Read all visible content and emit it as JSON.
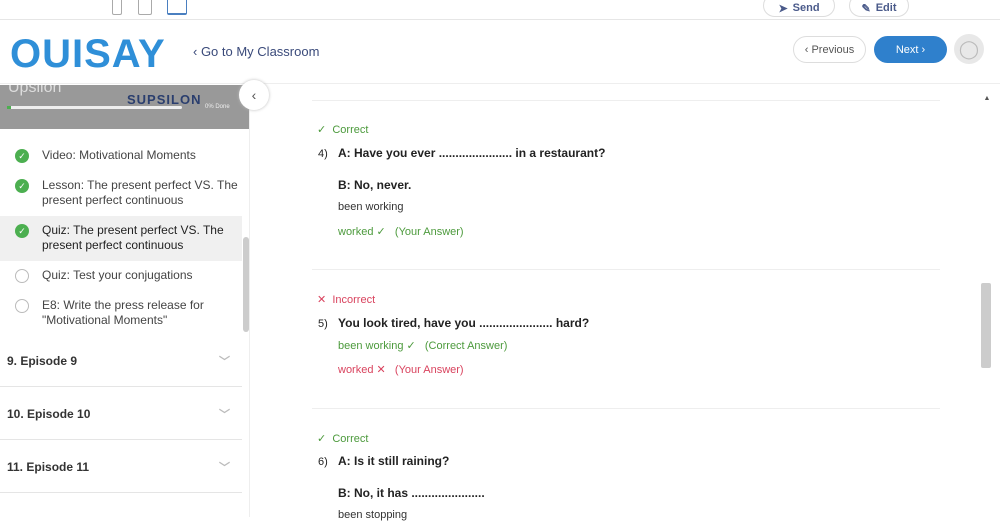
{
  "topbar": {
    "send": "Send",
    "edit": "Edit"
  },
  "header": {
    "logo": "OUISAY",
    "back": "‹ Go to My Classroom",
    "previous": "‹ Previous",
    "next": "Next ›"
  },
  "sidebar": {
    "title": "Upsilon",
    "brand": "SUPSILON",
    "progress_label": "0% Done",
    "progress": 0.02,
    "items": [
      {
        "label": "Video: Motivational Moments",
        "status": "complete"
      },
      {
        "label": "Lesson: The present perfect VS. The present perfect continuous",
        "status": "complete"
      },
      {
        "label": "Quiz: The present perfect VS. The present perfect continuous",
        "status": "complete",
        "active": true
      },
      {
        "label": "Quiz: Test your conjugations",
        "status": "incomplete"
      },
      {
        "label": "E8: Write the press release for \"Motivational Moments\"",
        "status": "incomplete"
      }
    ],
    "episodes": [
      "9. Episode 9",
      "10. Episode 10",
      "11. Episode 11"
    ]
  },
  "quiz": [
    {
      "status": "Correct",
      "num": "4)",
      "question": "A: Have you ever ...................... in a restaurant?",
      "line2": "B: No, never.",
      "option": "been working",
      "answer": "worked ✓",
      "answer_note": "(Your Answer)"
    },
    {
      "status": "Incorrect",
      "num": "5)",
      "question": "You look tired, have you ...................... hard?",
      "correct": "been working ✓",
      "correct_note": "(Correct Answer)",
      "answer": "worked ✕",
      "answer_note": "(Your Answer)"
    },
    {
      "status": "Correct",
      "num": "6)",
      "question": "A: Is it still raining?",
      "line2": "B: No, it has ......................",
      "option": "been stopping"
    }
  ],
  "colors": {
    "brand": "#2f8fd8",
    "correct": "#4c9a3c",
    "incorrect": "#d9435e",
    "next": "#2f80cc"
  }
}
